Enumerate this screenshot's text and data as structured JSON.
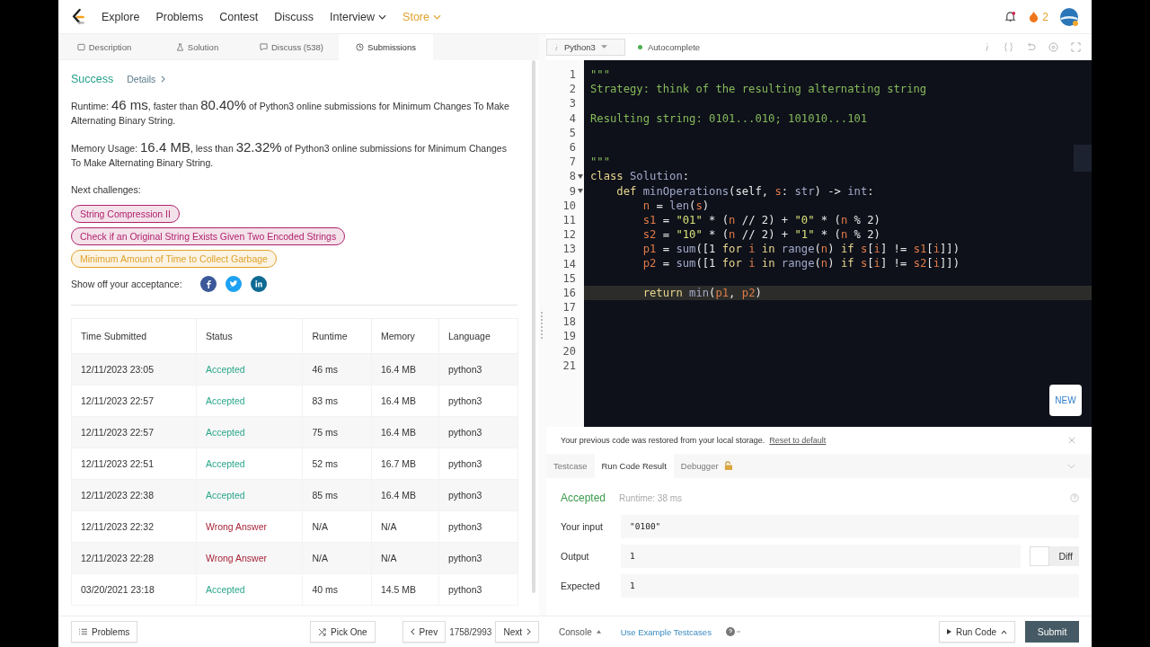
{
  "nav": {
    "items": [
      {
        "label": "Explore",
        "kind": "link"
      },
      {
        "label": "Problems",
        "kind": "link"
      },
      {
        "label": "Contest",
        "kind": "link"
      },
      {
        "label": "Discuss",
        "kind": "link"
      },
      {
        "label": "Interview",
        "kind": "menu"
      },
      {
        "label": "Store",
        "kind": "store"
      }
    ],
    "streak": "2"
  },
  "tabs": [
    {
      "label": "Description",
      "selected": false
    },
    {
      "label": "Solution",
      "selected": false
    },
    {
      "label": "Discuss (538)",
      "selected": false
    },
    {
      "label": "Submissions",
      "selected": true
    }
  ],
  "result": {
    "status": "Success",
    "details": "Details",
    "runtime": {
      "label": "Runtime:",
      "value": "46 ms",
      "mid": ", faster than",
      "pct": "80.40%",
      "rest": "of Python3 online submissions for Minimum Changes To Make Alternating Binary String."
    },
    "memory": {
      "label": "Memory Usage:",
      "value": "16.4 MB",
      "mid": ", less than",
      "pct": "32.32%",
      "rest": "of Python3 online submissions for Minimum Changes To Make Alternating Binary String."
    }
  },
  "next_label": "Next challenges:",
  "challenges": [
    {
      "label": "String Compression II",
      "color": "#b0226b"
    },
    {
      "label": "Check if an Original String Exists Given Two Encoded Strings",
      "color": "#b0226b"
    },
    {
      "label": "Minimum Amount of Time to Collect Garbage",
      "color": "#e0a22b"
    }
  ],
  "share_label": "Show off your acceptance:",
  "table": {
    "columns": [
      "Time Submitted",
      "Status",
      "Runtime",
      "Memory",
      "Language"
    ],
    "rows": [
      {
        "time": "12/11/2023 23:05",
        "status": "Accepted",
        "kind": "accepted",
        "runtime": "46 ms",
        "memory": "16.4 MB",
        "language": "python3"
      },
      {
        "time": "12/11/2023 22:57",
        "status": "Accepted",
        "kind": "accepted",
        "runtime": "83 ms",
        "memory": "16.4 MB",
        "language": "python3"
      },
      {
        "time": "12/11/2023 22:57",
        "status": "Accepted",
        "kind": "accepted",
        "runtime": "75 ms",
        "memory": "16.4 MB",
        "language": "python3"
      },
      {
        "time": "12/11/2023 22:51",
        "status": "Accepted",
        "kind": "accepted",
        "runtime": "52 ms",
        "memory": "16.7 MB",
        "language": "python3"
      },
      {
        "time": "12/11/2023 22:38",
        "status": "Accepted",
        "kind": "accepted",
        "runtime": "85 ms",
        "memory": "16.4 MB",
        "language": "python3"
      },
      {
        "time": "12/11/2023 22:32",
        "status": "Wrong Answer",
        "kind": "wrong",
        "runtime": "N/A",
        "memory": "N/A",
        "language": "python3"
      },
      {
        "time": "12/11/2023 22:28",
        "status": "Wrong Answer",
        "kind": "wrong",
        "runtime": "N/A",
        "memory": "N/A",
        "language": "python3"
      },
      {
        "time": "03/20/2021 23:18",
        "status": "Accepted",
        "kind": "accepted",
        "runtime": "40 ms",
        "memory": "14.5 MB",
        "language": "python3"
      }
    ]
  },
  "editor": {
    "language": "Python3",
    "autocomplete": "Autocomplete",
    "new_badge": "NEW",
    "lines": [
      {
        "no": "1",
        "fold": false,
        "current": false,
        "tokens": [
          {
            "kind": "comment",
            "text": "\"\"\""
          }
        ]
      },
      {
        "no": "2",
        "fold": false,
        "current": false,
        "tokens": [
          {
            "kind": "comment",
            "text": "Strategy: think of the resulting alternating string"
          }
        ]
      },
      {
        "no": "3",
        "fold": false,
        "current": false
      },
      {
        "no": "4",
        "fold": false,
        "current": false,
        "tokens": [
          {
            "kind": "comment",
            "text": "Resulting string: 0101...010; 101010...101"
          }
        ]
      },
      {
        "no": "5",
        "fold": false,
        "current": false
      },
      {
        "no": "6",
        "fold": false,
        "current": false
      },
      {
        "no": "7",
        "fold": false,
        "current": false,
        "tokens": [
          {
            "kind": "comment",
            "text": "\"\"\""
          }
        ]
      },
      {
        "no": "8",
        "fold": true,
        "current": false,
        "tokens": [
          {
            "kind": "keyword",
            "text": "class "
          },
          {
            "kind": "name",
            "text": "Solution"
          },
          {
            "kind": "plain",
            "text": ":"
          }
        ]
      },
      {
        "no": "9",
        "fold": true,
        "current": false,
        "tokens": [
          {
            "kind": "keyword",
            "text": "    def "
          },
          {
            "kind": "name",
            "text": "minOperations"
          },
          {
            "kind": "plain",
            "text": "(self, "
          },
          {
            "kind": "var",
            "text": "s"
          },
          {
            "kind": "plain",
            "text": ": "
          },
          {
            "kind": "name",
            "text": "str"
          },
          {
            "kind": "plain",
            "text": ") -> "
          },
          {
            "kind": "name",
            "text": "int"
          },
          {
            "kind": "plain",
            "text": ":"
          }
        ]
      },
      {
        "no": "10",
        "fold": false,
        "current": false,
        "tokens": [
          {
            "kind": "var",
            "text": "        n"
          },
          {
            "kind": "plain",
            "text": " = "
          },
          {
            "kind": "name",
            "text": "len"
          },
          {
            "kind": "plain",
            "text": "("
          },
          {
            "kind": "var",
            "text": "s"
          },
          {
            "kind": "plain",
            "text": ")"
          }
        ]
      },
      {
        "no": "11",
        "fold": false,
        "current": false,
        "tokens": [
          {
            "kind": "var",
            "text": "        s1"
          },
          {
            "kind": "plain",
            "text": " = "
          },
          {
            "kind": "string",
            "text": "\"01\""
          },
          {
            "kind": "plain",
            "text": " * ("
          },
          {
            "kind": "var",
            "text": "n"
          },
          {
            "kind": "plain",
            "text": " // 2) + "
          },
          {
            "kind": "string",
            "text": "\"0\""
          },
          {
            "kind": "plain",
            "text": " * ("
          },
          {
            "kind": "var",
            "text": "n"
          },
          {
            "kind": "plain",
            "text": " % 2)"
          }
        ]
      },
      {
        "no": "12",
        "fold": false,
        "current": false,
        "tokens": [
          {
            "kind": "var",
            "text": "        s2"
          },
          {
            "kind": "plain",
            "text": " = "
          },
          {
            "kind": "string",
            "text": "\"10\""
          },
          {
            "kind": "plain",
            "text": " * ("
          },
          {
            "kind": "var",
            "text": "n"
          },
          {
            "kind": "plain",
            "text": " // 2) + "
          },
          {
            "kind": "string",
            "text": "\"1\""
          },
          {
            "kind": "plain",
            "text": " * ("
          },
          {
            "kind": "var",
            "text": "n"
          },
          {
            "kind": "plain",
            "text": " % 2)"
          }
        ]
      },
      {
        "no": "13",
        "fold": false,
        "current": false,
        "tokens": [
          {
            "kind": "var",
            "text": "        p1"
          },
          {
            "kind": "plain",
            "text": " = "
          },
          {
            "kind": "name",
            "text": "sum"
          },
          {
            "kind": "plain",
            "text": "([1 "
          },
          {
            "kind": "keyword",
            "text": "for "
          },
          {
            "kind": "var",
            "text": "i"
          },
          {
            "kind": "keyword",
            "text": " in "
          },
          {
            "kind": "name",
            "text": "range"
          },
          {
            "kind": "plain",
            "text": "("
          },
          {
            "kind": "var",
            "text": "n"
          },
          {
            "kind": "plain",
            "text": ") "
          },
          {
            "kind": "keyword",
            "text": "if "
          },
          {
            "kind": "var",
            "text": "s"
          },
          {
            "kind": "plain",
            "text": "["
          },
          {
            "kind": "var",
            "text": "i"
          },
          {
            "kind": "plain",
            "text": "] != "
          },
          {
            "kind": "var",
            "text": "s1"
          },
          {
            "kind": "plain",
            "text": "["
          },
          {
            "kind": "var",
            "text": "i"
          },
          {
            "kind": "plain",
            "text": "]])"
          }
        ]
      },
      {
        "no": "14",
        "fold": false,
        "current": false,
        "tokens": [
          {
            "kind": "var",
            "text": "        p2"
          },
          {
            "kind": "plain",
            "text": " = "
          },
          {
            "kind": "name",
            "text": "sum"
          },
          {
            "kind": "plain",
            "text": "([1 "
          },
          {
            "kind": "keyword",
            "text": "for "
          },
          {
            "kind": "var",
            "text": "i"
          },
          {
            "kind": "keyword",
            "text": " in "
          },
          {
            "kind": "name",
            "text": "range"
          },
          {
            "kind": "plain",
            "text": "("
          },
          {
            "kind": "var",
            "text": "n"
          },
          {
            "kind": "plain",
            "text": ") "
          },
          {
            "kind": "keyword",
            "text": "if "
          },
          {
            "kind": "var",
            "text": "s"
          },
          {
            "kind": "plain",
            "text": "["
          },
          {
            "kind": "var",
            "text": "i"
          },
          {
            "kind": "plain",
            "text": "] != "
          },
          {
            "kind": "var",
            "text": "s2"
          },
          {
            "kind": "plain",
            "text": "["
          },
          {
            "kind": "var",
            "text": "i"
          },
          {
            "kind": "plain",
            "text": "]])"
          }
        ]
      },
      {
        "no": "15",
        "fold": false,
        "current": false
      },
      {
        "no": "16",
        "fold": false,
        "current": true,
        "tokens": [
          {
            "kind": "keyword",
            "text": "        return "
          },
          {
            "kind": "name",
            "text": "min"
          },
          {
            "kind": "plain",
            "text": "("
          },
          {
            "kind": "var",
            "text": "p1"
          },
          {
            "kind": "plain",
            "text": ", "
          },
          {
            "kind": "var",
            "text": "p2"
          },
          {
            "kind": "plain",
            "text": ")"
          }
        ]
      },
      {
        "no": "17",
        "fold": false,
        "current": false
      },
      {
        "no": "18",
        "fold": false,
        "current": false
      },
      {
        "no": "19",
        "fold": false,
        "current": false
      },
      {
        "no": "20",
        "fold": false,
        "current": false
      },
      {
        "no": "21",
        "fold": false,
        "current": false
      }
    ]
  },
  "notice": {
    "text": "Your previous code was restored from your local storage.",
    "link": "Reset to default"
  },
  "console_tabs": [
    {
      "label": "Testcase",
      "selected": false,
      "locked": false
    },
    {
      "label": "Run Code Result",
      "selected": true,
      "locked": false
    },
    {
      "label": "Debugger",
      "selected": false,
      "locked": true
    }
  ],
  "run_result": {
    "status": "Accepted",
    "runtime": "Runtime: 38 ms",
    "fields": [
      {
        "label": "Your input",
        "value": "\"0100\""
      },
      {
        "label": "Output",
        "value": "1"
      },
      {
        "label": "Expected",
        "value": "1"
      }
    ],
    "diff": {
      "label": "Diff",
      "on": false
    }
  },
  "footer": {
    "problems": "Problems",
    "pick": "Pick One",
    "prev": "Prev",
    "position": "1758/2993",
    "next": "Next",
    "console": "Console",
    "examples": "Use Example Testcases",
    "run": "Run Code",
    "submit": "Submit"
  }
}
